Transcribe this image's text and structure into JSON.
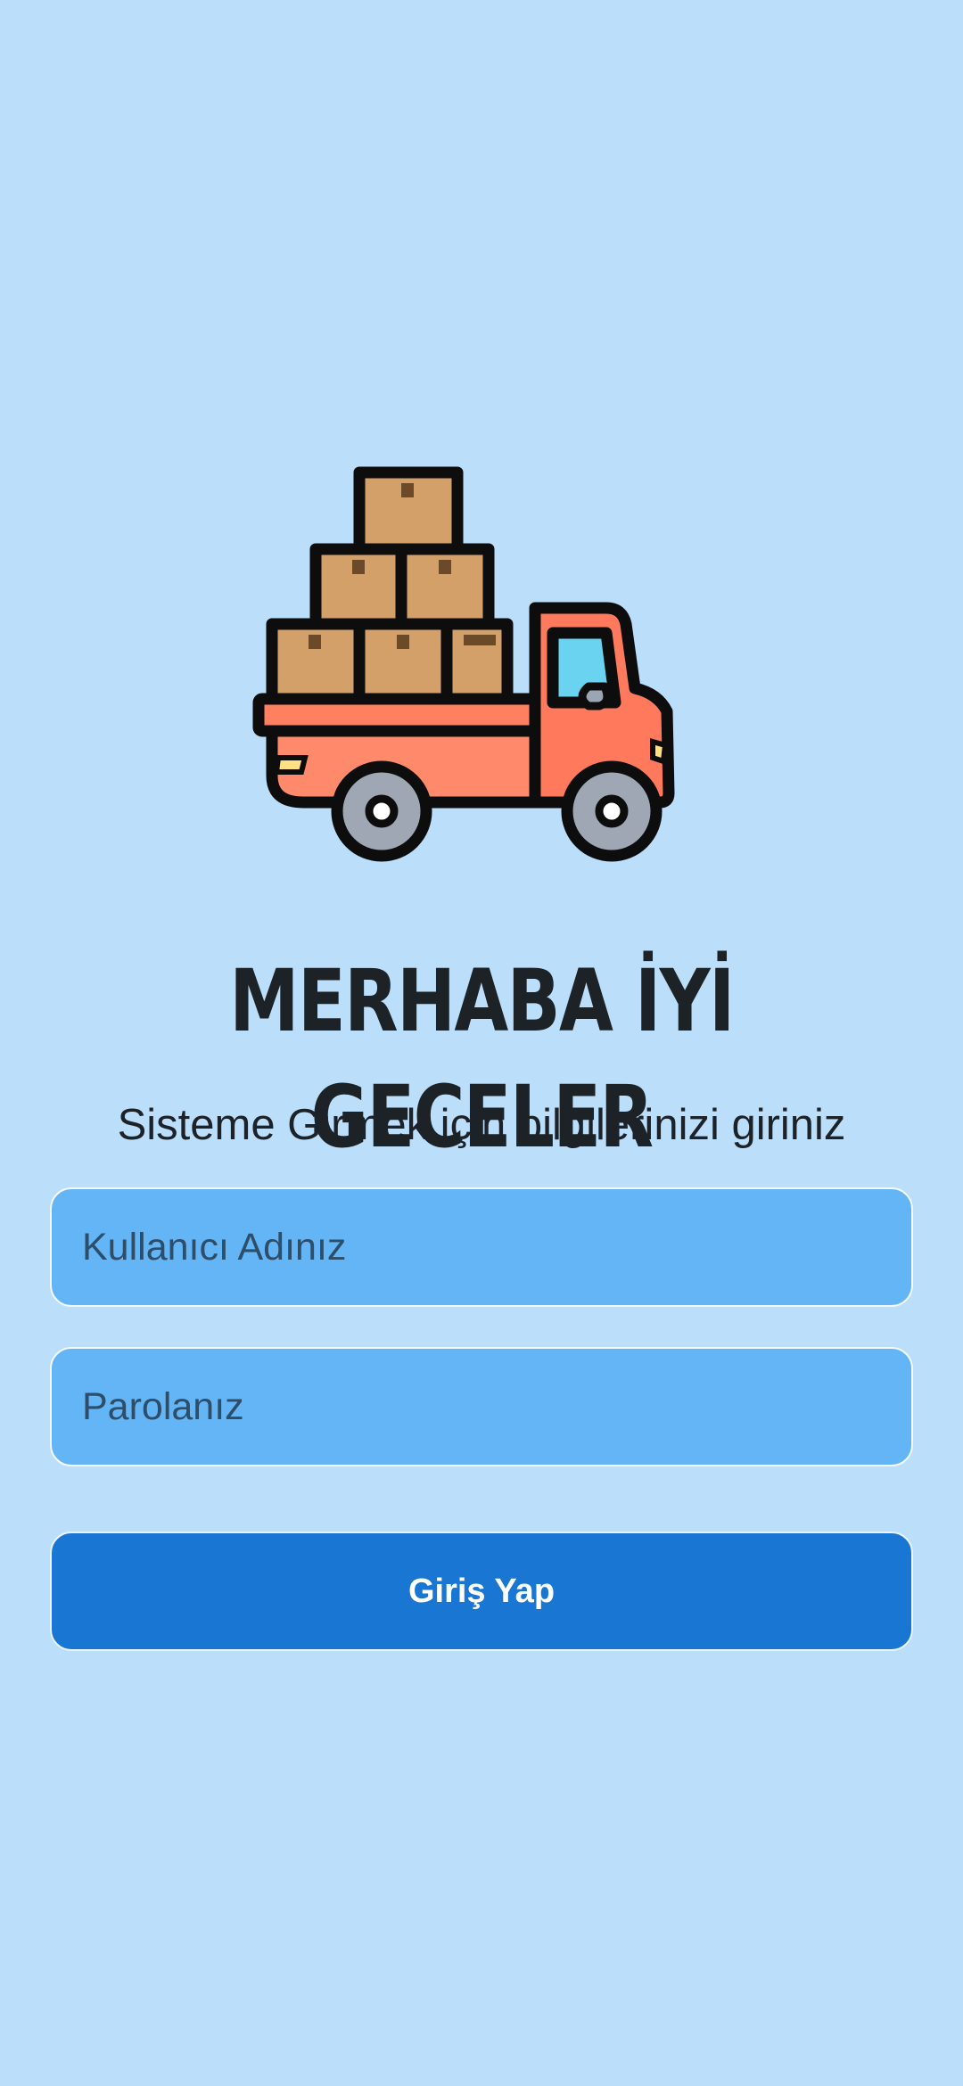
{
  "logo": {
    "icon": "delivery-truck-with-boxes-icon"
  },
  "header": {
    "title": "MERHABA İYİ GECELER",
    "subtitle": "Sisteme Girmek için bilgilerinizi giriniz"
  },
  "form": {
    "username": {
      "placeholder": "Kullanıcı Adınız",
      "value": ""
    },
    "password": {
      "placeholder": "Parolanız",
      "value": ""
    },
    "login_label": "Giriş Yap"
  },
  "colors": {
    "background": "#bbdefb",
    "field_fill": "#64b5f6",
    "button_fill": "#1976d2",
    "truck_body": "#ff8a65",
    "box": "#d4a06a",
    "window": "#6ad3f0"
  }
}
